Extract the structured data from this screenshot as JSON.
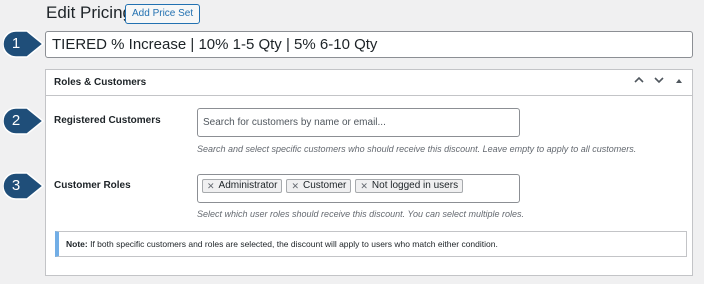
{
  "header": {
    "title": "Edit Pricing",
    "add_button": "Add Price Set"
  },
  "title_field": {
    "value": "TIERED % Increase | 10% 1-5 Qty | 5% 6-10 Qty"
  },
  "callouts": [
    "1",
    "2",
    "3"
  ],
  "panel": {
    "title": "Roles & Customers",
    "actions": {
      "up_icon": "chevron-up-icon",
      "down_icon": "chevron-down-icon",
      "collapse_icon": "triangle-up-icon"
    },
    "registered_customers": {
      "label": "Registered Customers",
      "placeholder": "Search for customers by name or email...",
      "help": "Search and select specific customers who should receive this discount. Leave empty to apply to all customers."
    },
    "customer_roles": {
      "label": "Customer Roles",
      "selected": [
        "Administrator",
        "Customer",
        "Not logged in users"
      ],
      "help": "Select which user roles should receive this discount. You can select multiple roles."
    },
    "note": {
      "prefix": "Note:",
      "text": " If both specific customers and roles are selected, the discount will apply to users who match either condition."
    }
  },
  "colors": {
    "callout_fill": "#1f4e79",
    "accent": "#2271b1",
    "note_border": "#72aee6"
  }
}
